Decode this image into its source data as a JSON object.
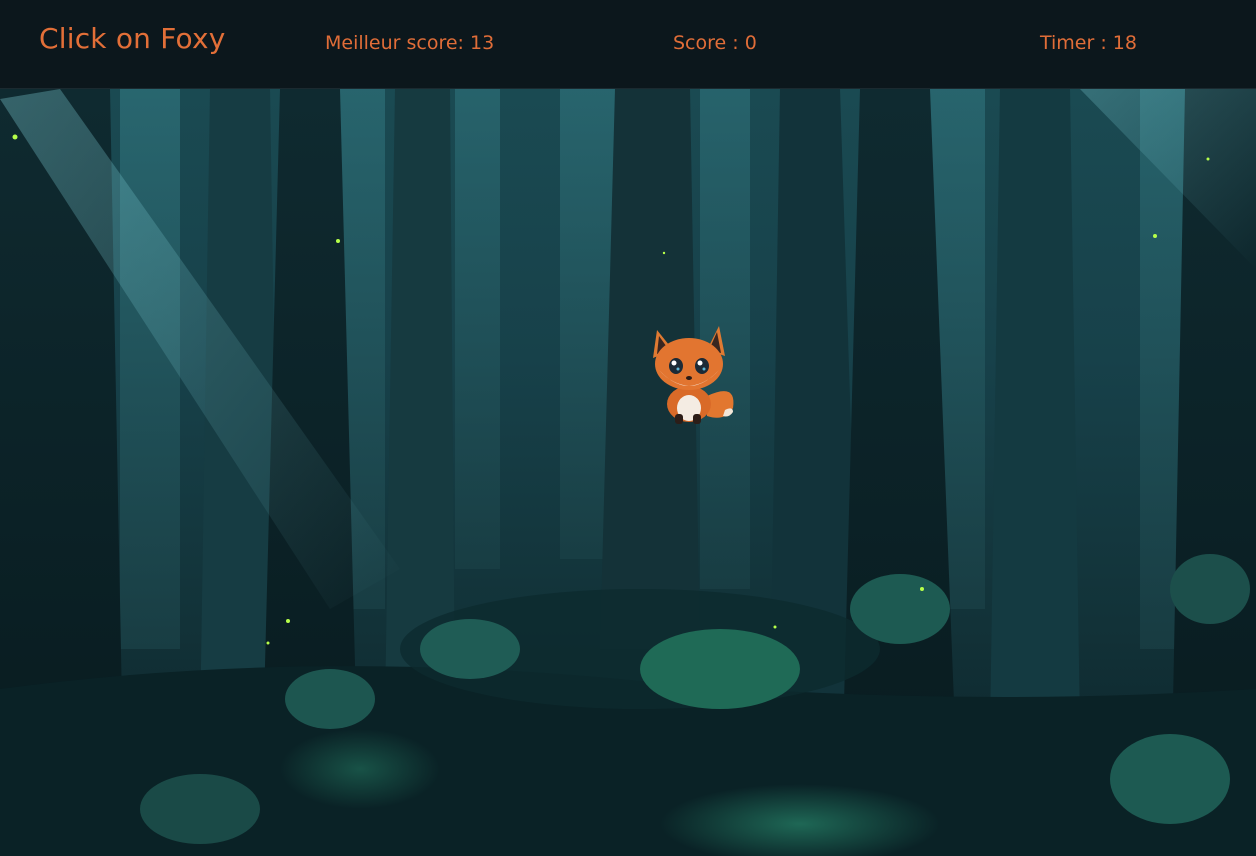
{
  "header": {
    "title": "Click on Foxy",
    "best_score": "Meilleur score: 13",
    "score": "Score : 0",
    "timer": "Timer : 18"
  },
  "game": {
    "target": "fox-sprite",
    "background": "dark-forest"
  },
  "colors": {
    "accent": "#e26f38",
    "header_bg": "#0c171c"
  }
}
